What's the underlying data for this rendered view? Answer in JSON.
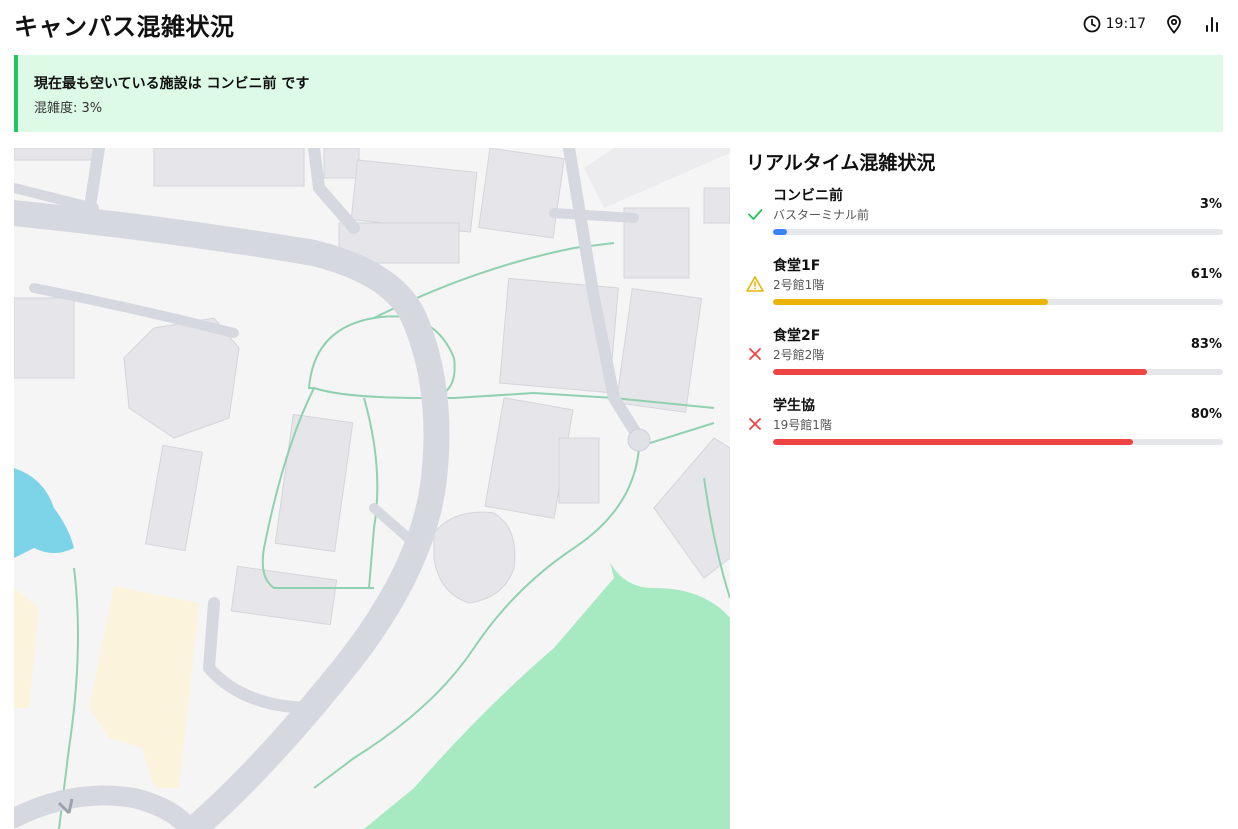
{
  "header": {
    "title": "キャンパス混雑状況",
    "time": "19:17",
    "icons": [
      "clock-icon",
      "map-pin-icon",
      "bar-chart-icon"
    ]
  },
  "banner": {
    "title": "現在最も空いている施設は コンビニ前 です",
    "subtitle": "混雑度: 3%",
    "accent_color": "#22c55e",
    "background_color": "#dcfae6"
  },
  "panel": {
    "title": "リアルタイム混雑状況",
    "facilities": [
      {
        "name": "コンビニ前",
        "location": "バスターミナル前",
        "percent_label": "3%",
        "level": 0.03,
        "status_icon": "check-icon",
        "color": "#3b82f6"
      },
      {
        "name": "食堂1F",
        "location": "2号館1階",
        "percent_label": "61%",
        "level": 0.61,
        "status_icon": "warning-icon",
        "color": "#eab308"
      },
      {
        "name": "食堂2F",
        "location": "2号館2階",
        "percent_label": "83%",
        "level": 0.83,
        "status_icon": "x-icon",
        "color": "#ef4444"
      },
      {
        "name": "学生協",
        "location": "19号館1階",
        "percent_label": "80%",
        "level": 0.8,
        "status_icon": "x-icon",
        "color": "#ef4444"
      }
    ]
  }
}
